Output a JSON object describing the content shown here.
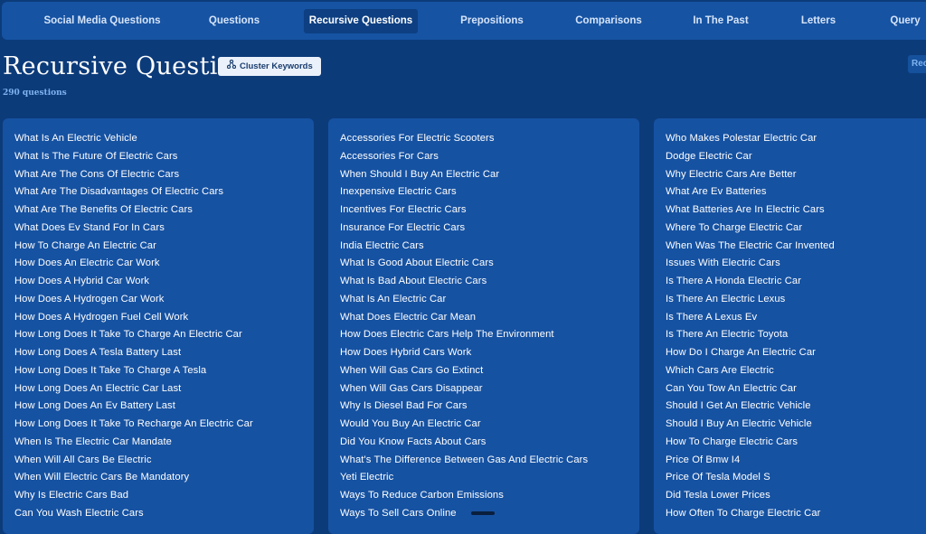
{
  "nav": {
    "tabs": [
      {
        "label": "Social Media Questions"
      },
      {
        "label": "Questions"
      },
      {
        "label": "Recursive Questions"
      },
      {
        "label": "Prepositions"
      },
      {
        "label": "Comparisons"
      },
      {
        "label": "In The Past"
      },
      {
        "label": "Letters"
      },
      {
        "label": "Query"
      }
    ],
    "active": "Recursive Questions"
  },
  "header": {
    "title": "Recursive Questions",
    "cluster_button": "Cluster Keywords",
    "right_tag": "Rec",
    "count": "290 questions"
  },
  "columns": [
    {
      "items": [
        "What Is An Electric Vehicle",
        "What Is The Future Of Electric Cars",
        "What Are The Cons Of Electric Cars",
        "What Are The Disadvantages Of Electric Cars",
        "What Are The Benefits Of Electric Cars",
        "What Does Ev Stand For In Cars",
        "How To Charge An Electric Car",
        "How Does An Electric Car Work",
        "How Does A Hybrid Car Work",
        "How Does A Hydrogen Car Work",
        "How Does A Hydrogen Fuel Cell Work",
        "How Long Does It Take To Charge An Electric Car",
        "How Long Does A Tesla Battery Last",
        "How Long Does It Take To Charge A Tesla",
        "How Long Does An Electric Car Last",
        "How Long Does An Ev Battery Last",
        "How Long Does It Take To Recharge An Electric Car",
        "When Is The Electric Car Mandate",
        "When Will All Cars Be Electric",
        "When Will Electric Cars Be Mandatory",
        "Why Is Electric Cars Bad",
        "Can You Wash Electric Cars"
      ]
    },
    {
      "items": [
        "Accessories For Electric Scooters",
        "Accessories For Cars",
        "When Should I Buy An Electric Car",
        "Inexpensive Electric Cars",
        "Incentives For Electric Cars",
        "Insurance For Electric Cars",
        "India Electric Cars",
        "What Is Good About Electric Cars",
        "What Is Bad About Electric Cars",
        "What Is An Electric Car",
        "What Does Electric Car Mean",
        "How Does Electric Cars Help The Environment",
        "How Does Hybrid Cars Work",
        "When Will Gas Cars Go Extinct",
        "When Will Gas Cars Disappear",
        "Why Is Diesel Bad For Cars",
        "Would You Buy An Electric Car",
        "Did You Know Facts About Cars",
        "What's The Difference Between Gas And Electric Cars",
        "Yeti Electric",
        "Ways To Reduce Carbon Emissions",
        "Ways To Sell Cars Online"
      ]
    },
    {
      "items": [
        "Who Makes Polestar Electric Car",
        "Dodge Electric Car",
        "Why Electric Cars Are Better",
        "What Are Ev Batteries",
        "What Batteries Are In Electric Cars",
        "Where To Charge Electric Car",
        "When Was The Electric Car Invented",
        "Issues With Electric Cars",
        "Is There A Honda Electric Car",
        "Is There An Electric Lexus",
        "Is There A Lexus Ev",
        "Is There An Electric Toyota",
        "How Do I Charge An Electric Car",
        "Which Cars Are Electric",
        "Can You Tow An Electric Car",
        "Should I Get An Electric Vehicle",
        "Should I Buy An Electric Vehicle",
        "How To Charge Electric Cars",
        "Price Of Bmw I4",
        "Price Of Tesla Model S",
        "Did Tesla Lower Prices",
        "How Often To Charge Electric Car"
      ]
    }
  ]
}
